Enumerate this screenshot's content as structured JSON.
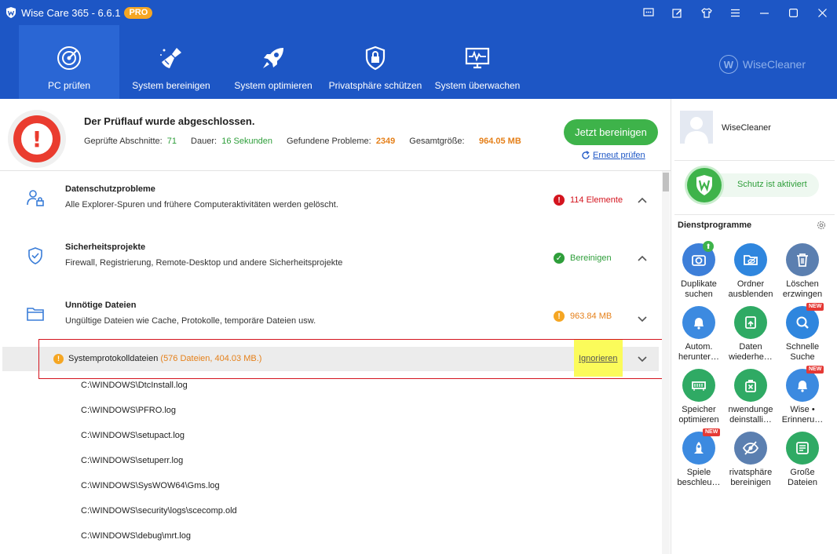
{
  "window": {
    "title": "Wise Care 365 - 6.6.1",
    "badge": "PRO"
  },
  "nav": [
    {
      "label": "PC prüfen",
      "icon": "radar-icon"
    },
    {
      "label": "System bereinigen",
      "icon": "broom-icon"
    },
    {
      "label": "System optimieren",
      "icon": "rocket-icon"
    },
    {
      "label": "Privatsphäre schützen",
      "icon": "shield-lock-icon"
    },
    {
      "label": "System überwachen",
      "icon": "monitor-pulse-icon"
    }
  ],
  "brand": {
    "name": "WiseCleaner",
    "initial": "W"
  },
  "summary": {
    "title": "Der Prüflauf wurde abgeschlossen.",
    "checked_label": "Geprüfte Abschnitte:",
    "checked_value": "71",
    "duration_label": "Dauer:",
    "duration_value": "16 Sekunden",
    "found_label": "Gefundene Probleme:",
    "found_value": "2349",
    "size_label": "Gesamtgröße:",
    "size_value": "964.05 MB",
    "clean_button": "Jetzt bereinigen",
    "rescan": "Erneut prüfen"
  },
  "categories": [
    {
      "title": "Datenschutzprobleme",
      "desc": "Alle Explorer-Spuren und frühere Computeraktivitäten werden gelöscht.",
      "status": "114 Elemente",
      "status_color": "#d4141e"
    },
    {
      "title": "Sicherheitsprojekte",
      "desc": "Firewall, Registrierung, Remote-Desktop und andere Sicherheitsprojekte",
      "status": "Bereinigen",
      "status_color": "#2e9e3a"
    },
    {
      "title": "Unnötige Dateien",
      "desc": "Ungültige Dateien wie Cache, Protokolle, temporäre Dateien usw.",
      "status": "963.84 MB",
      "status_color": "#e5801a"
    }
  ],
  "subitem": {
    "name": "Systemprotokolldateien",
    "detail": "(576 Dateien, 404.03 MB.)",
    "ignore": "Ignorieren"
  },
  "files": [
    "C:\\WINDOWS\\DtcInstall.log",
    "C:\\WINDOWS\\PFRO.log",
    "C:\\WINDOWS\\setupact.log",
    "C:\\WINDOWS\\setuperr.log",
    "C:\\WINDOWS\\SysWOW64\\Gms.log",
    "C:\\WINDOWS\\security\\logs\\scecomp.old",
    "C:\\WINDOWS\\debug\\mrt.log"
  ],
  "side": {
    "user": "WiseCleaner",
    "protection": "Schutz ist aktiviert",
    "tools_title": "Dienstprogramme",
    "tools": [
      {
        "l1": "Duplikate",
        "l2": "suchen",
        "color": "#3d7fd9",
        "icon": "duplicate-photo-icon",
        "badge": "up"
      },
      {
        "l1": "Ordner",
        "l2": "ausblenden",
        "color": "#2f86de",
        "icon": "folder-hide-icon"
      },
      {
        "l1": "Löschen",
        "l2": "erzwingen",
        "color": "#5b7fb0",
        "icon": "trash-icon"
      },
      {
        "l1": "Autom.",
        "l2": "herunter…",
        "color": "#3c8ae0",
        "icon": "bell-icon"
      },
      {
        "l1": "Daten",
        "l2": "wiederhe…",
        "color": "#2faa64",
        "icon": "restore-icon"
      },
      {
        "l1": "Schnelle",
        "l2": "Suche",
        "color": "#2f86de",
        "icon": "magnifier-icon",
        "badge": "NEW"
      },
      {
        "l1": "Speicher",
        "l2": "optimieren",
        "color": "#2faa64",
        "icon": "memory-icon"
      },
      {
        "l1": "nwendunge",
        "l2": "deinstalli…",
        "color": "#2faa64",
        "icon": "uninstall-icon"
      },
      {
        "l1": "Wise •",
        "l2": "Erinneru…",
        "color": "#3c8ae0",
        "icon": "reminder-bell-icon",
        "badge": "NEW"
      },
      {
        "l1": "Spiele",
        "l2": "beschleu…",
        "color": "#3c8ae0",
        "icon": "game-rocket-icon",
        "badge": "NEW"
      },
      {
        "l1": "rivatsphäre",
        "l2": "bereinigen",
        "color": "#5b7fb0",
        "icon": "eye-off-icon"
      },
      {
        "l1": "Große",
        "l2": "Dateien",
        "color": "#2faa64",
        "icon": "large-file-icon"
      }
    ]
  }
}
